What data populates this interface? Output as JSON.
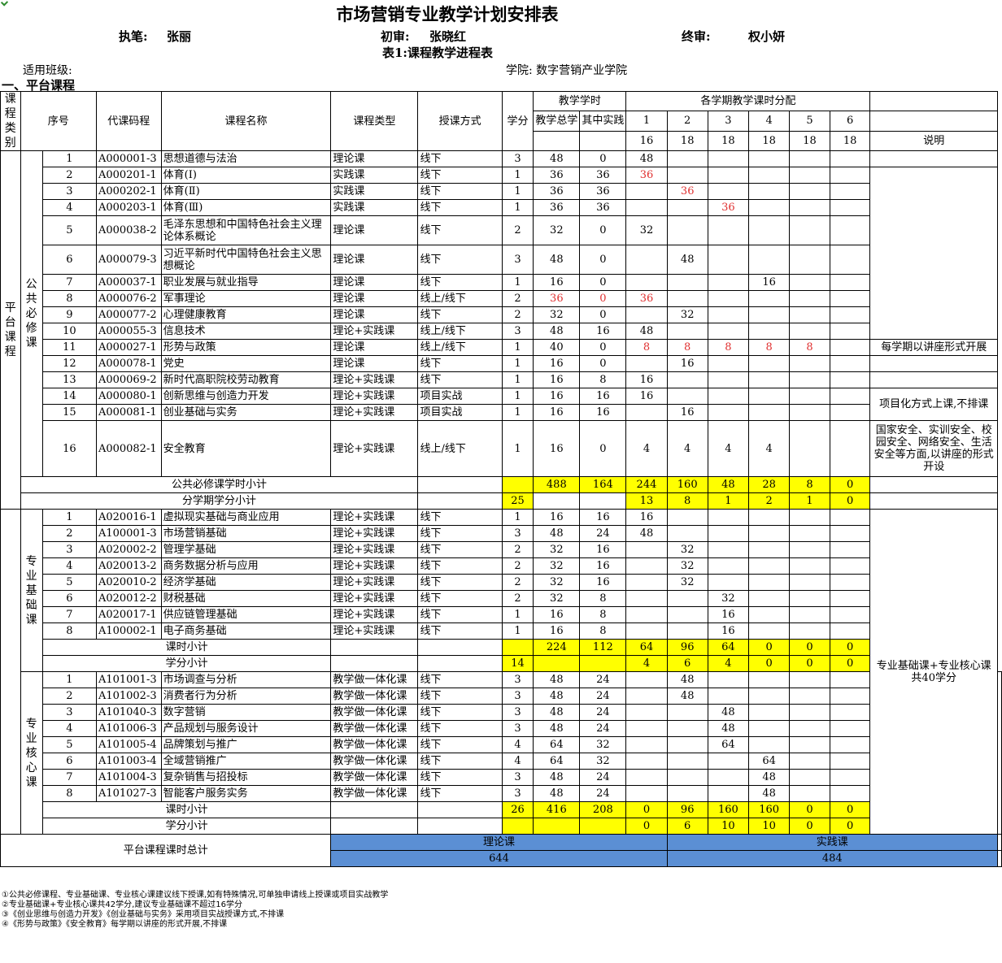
{
  "title": "市场营销专业教学计划安排表",
  "authors": {
    "writer_label": "执笔:",
    "writer": "张丽",
    "review_label": "初审:",
    "reviewer": "张晓红",
    "final_label": "终审:",
    "final": "权小妍"
  },
  "table_title": "表1:课程教学进程表",
  "class_label": "适用班级:",
  "college": "学院: 数字营销产业学院",
  "section": "一、平台课程",
  "header": {
    "category": "课程类别",
    "no": "序号",
    "code": "代课码程",
    "name": "课程名称",
    "type": "课程类型",
    "mode": "授课方式",
    "credit": "学分",
    "hours_group": "教学学时",
    "total": "教学总学",
    "practice": "其中实践",
    "sem_group": "各学期教学课时分配",
    "sems": [
      "1",
      "2",
      "3",
      "4",
      "5",
      "6"
    ],
    "weeks": [
      "16",
      "18",
      "18",
      "18",
      "18",
      "18"
    ],
    "note": "说明"
  },
  "platform_label": "平台课程",
  "groups": {
    "public": "公共必修课",
    "basic": "专业基础课",
    "core": "专业核心课"
  },
  "public_rows": [
    {
      "no": "1",
      "code": "A000001-3",
      "name": "思想道德与法治",
      "type": "理论课",
      "mode": "线下",
      "credit": "3",
      "total": "48",
      "prac": "0",
      "s": [
        "48",
        "",
        "",
        "",
        "",
        ""
      ]
    },
    {
      "no": "2",
      "code": "A000201-1",
      "name": "体育(Ⅰ)",
      "type": "实践课",
      "mode": "线下",
      "credit": "1",
      "total": "36",
      "prac": "36",
      "s": [
        "36",
        "",
        "",
        "",
        "",
        ""
      ]
    },
    {
      "no": "3",
      "code": "A000202-1",
      "name": "体育(Ⅱ)",
      "type": "实践课",
      "mode": "线下",
      "credit": "1",
      "total": "36",
      "prac": "36",
      "s": [
        "",
        "36",
        "",
        "",
        "",
        ""
      ]
    },
    {
      "no": "4",
      "code": "A000203-1",
      "name": "体育(Ⅲ)",
      "type": "实践课",
      "mode": "线下",
      "credit": "1",
      "total": "36",
      "prac": "36",
      "s": [
        "",
        "",
        "36",
        "",
        "",
        ""
      ]
    },
    {
      "no": "5",
      "code": "A000038-2",
      "name": "毛泽东思想和中国特色社会主义理论体系概论",
      "type": "理论课",
      "mode": "线下",
      "credit": "2",
      "total": "32",
      "prac": "0",
      "s": [
        "32",
        "",
        "",
        "",
        "",
        ""
      ]
    },
    {
      "no": "6",
      "code": "A000079-3",
      "name": "习近平新时代中国特色社会主义思想概论",
      "type": "理论课",
      "mode": "线下",
      "credit": "3",
      "total": "48",
      "prac": "0",
      "s": [
        "",
        "48",
        "",
        "",
        "",
        ""
      ]
    },
    {
      "no": "7",
      "code": "A000037-1",
      "name": "职业发展与就业指导",
      "type": "理论课",
      "mode": "线下",
      "credit": "1",
      "total": "16",
      "prac": "0",
      "s": [
        "",
        "",
        "",
        "16",
        "",
        ""
      ]
    },
    {
      "no": "8",
      "code": "A000076-2",
      "name": "军事理论",
      "type": "理论课",
      "mode": "线上/线下",
      "credit": "2",
      "total": "36",
      "prac": "0",
      "s": [
        "36",
        "",
        "",
        "",
        "",
        ""
      ]
    },
    {
      "no": "9",
      "code": "A000077-2",
      "name": "心理健康教育",
      "type": "理论课",
      "mode": "线下",
      "credit": "2",
      "total": "32",
      "prac": "0",
      "s": [
        "",
        "32",
        "",
        "",
        "",
        ""
      ]
    },
    {
      "no": "10",
      "code": "A000055-3",
      "name": "信息技术",
      "type": "理论+实践课",
      "mode": "线上/线下",
      "credit": "3",
      "total": "48",
      "prac": "16",
      "s": [
        "48",
        "",
        "",
        "",
        "",
        ""
      ]
    },
    {
      "no": "11",
      "code": "A000027-1",
      "name": "形势与政策",
      "type": "理论课",
      "mode": "线上/线下",
      "credit": "1",
      "total": "40",
      "prac": "0",
      "s": [
        "8",
        "8",
        "8",
        "8",
        "8",
        ""
      ]
    },
    {
      "no": "12",
      "code": "A000078-1",
      "name": "党史",
      "type": "理论课",
      "mode": "线下",
      "credit": "1",
      "total": "16",
      "prac": "0",
      "s": [
        "",
        "16",
        "",
        "",
        "",
        ""
      ]
    },
    {
      "no": "13",
      "code": "A000069-2",
      "name": "新时代高职院校劳动教育",
      "type": "理论+实践课",
      "mode": "线下",
      "credit": "1",
      "total": "16",
      "prac": "8",
      "s": [
        "16",
        "",
        "",
        "",
        "",
        ""
      ]
    },
    {
      "no": "14",
      "code": "A000080-1",
      "name": "创新思维与创造力开发",
      "type": "理论+实践课",
      "mode": "项目实战",
      "credit": "1",
      "total": "16",
      "prac": "16",
      "s": [
        "16",
        "",
        "",
        "",
        "",
        ""
      ]
    },
    {
      "no": "15",
      "code": "A000081-1",
      "name": "创业基础与实务",
      "type": "理论+实践课",
      "mode": "项目实战",
      "credit": "1",
      "total": "16",
      "prac": "16",
      "s": [
        "",
        "16",
        "",
        "",
        "",
        ""
      ]
    },
    {
      "no": "16",
      "code": "A000082-1",
      "name": "安全教育",
      "type": "理论+实践课",
      "mode": "线上/线下",
      "credit": "1",
      "total": "16",
      "prac": "0",
      "s": [
        "4",
        "4",
        "4",
        "4",
        "",
        ""
      ]
    }
  ],
  "public_notes": {
    "n11": "每学期以讲座形式开展",
    "n14": "项目化方式上课,不排课",
    "n16": "国家安全、实训安全、校园安全、网络安全、生活安全等方面,以讲座的形式开设"
  },
  "public_hours_subtotal": {
    "label": "公共必修课学时小计",
    "total": "488",
    "prac": "164",
    "s": [
      "244",
      "160",
      "48",
      "28",
      "8",
      "0"
    ]
  },
  "public_credit_subtotal": {
    "label": "分学期学分小计",
    "credit": "25",
    "s": [
      "13",
      "8",
      "1",
      "2",
      "1",
      "0"
    ]
  },
  "basic_rows": [
    {
      "no": "1",
      "code": "A020016-1",
      "name": "虚拟现实基础与商业应用",
      "type": "理论+实践课",
      "mode": "线下",
      "credit": "1",
      "total": "16",
      "prac": "16",
      "s": [
        "16",
        "",
        "",
        "",
        "",
        ""
      ]
    },
    {
      "no": "2",
      "code": "A100001-3",
      "name": "市场营销基础",
      "type": "理论+实践课",
      "mode": "线下",
      "credit": "3",
      "total": "48",
      "prac": "24",
      "s": [
        "48",
        "",
        "",
        "",
        "",
        ""
      ]
    },
    {
      "no": "3",
      "code": "A020002-2",
      "name": "管理学基础",
      "type": "理论+实践课",
      "mode": "线下",
      "credit": "2",
      "total": "32",
      "prac": "16",
      "s": [
        "",
        "32",
        "",
        "",
        "",
        ""
      ]
    },
    {
      "no": "4",
      "code": "A020013-2",
      "name": "商务数据分析与应用",
      "type": "理论+实践课",
      "mode": "线下",
      "credit": "2",
      "total": "32",
      "prac": "16",
      "s": [
        "",
        "32",
        "",
        "",
        "",
        ""
      ]
    },
    {
      "no": "5",
      "code": "A020010-2",
      "name": "经济学基础",
      "type": "理论+实践课",
      "mode": "线下",
      "credit": "2",
      "total": "32",
      "prac": "16",
      "s": [
        "",
        "32",
        "",
        "",
        "",
        ""
      ]
    },
    {
      "no": "6",
      "code": "A020012-2",
      "name": "财税基础",
      "type": "理论+实践课",
      "mode": "线下",
      "credit": "2",
      "total": "32",
      "prac": "8",
      "s": [
        "",
        "",
        "32",
        "",
        "",
        ""
      ]
    },
    {
      "no": "7",
      "code": "A020017-1",
      "name": "供应链管理基础",
      "type": "理论+实践课",
      "mode": "线下",
      "credit": "1",
      "total": "16",
      "prac": "8",
      "s": [
        "",
        "",
        "16",
        "",
        "",
        ""
      ]
    },
    {
      "no": "8",
      "code": "A100002-1",
      "name": "电子商务基础",
      "type": "理论+实践课",
      "mode": "线下",
      "credit": "1",
      "total": "16",
      "prac": "8",
      "s": [
        "",
        "",
        "16",
        "",
        "",
        ""
      ]
    }
  ],
  "basic_hours_subtotal": {
    "label": "课时小计",
    "total": "224",
    "prac": "112",
    "s": [
      "64",
      "96",
      "64",
      "0",
      "0",
      "0"
    ]
  },
  "basic_credit_subtotal": {
    "label": "学分小计",
    "credit": "14",
    "s": [
      "4",
      "6",
      "4",
      "0",
      "0",
      "0"
    ]
  },
  "basic_core_note": "专业基础课+专业核心课共40学分",
  "core_rows": [
    {
      "no": "1",
      "code": "A101001-3",
      "name": "市场调查与分析",
      "type": "教学做一体化课",
      "mode": "线下",
      "credit": "3",
      "total": "48",
      "prac": "24",
      "s": [
        "",
        "48",
        "",
        "",
        "",
        ""
      ]
    },
    {
      "no": "2",
      "code": "A101002-3",
      "name": "消费者行为分析",
      "type": "教学做一体化课",
      "mode": "线下",
      "credit": "3",
      "total": "48",
      "prac": "24",
      "s": [
        "",
        "48",
        "",
        "",
        "",
        ""
      ]
    },
    {
      "no": "3",
      "code": "A101040-3",
      "name": "数字营销",
      "type": "教学做一体化课",
      "mode": "线下",
      "credit": "3",
      "total": "48",
      "prac": "24",
      "s": [
        "",
        "",
        "48",
        "",
        "",
        ""
      ]
    },
    {
      "no": "4",
      "code": "A101006-3",
      "name": "产品规划与服务设计",
      "type": "教学做一体化课",
      "mode": "线下",
      "credit": "3",
      "total": "48",
      "prac": "24",
      "s": [
        "",
        "",
        "48",
        "",
        "",
        ""
      ]
    },
    {
      "no": "5",
      "code": "A101005-4",
      "name": "品牌策划与推广",
      "type": "教学做一体化课",
      "mode": "线下",
      "credit": "4",
      "total": "64",
      "prac": "32",
      "s": [
        "",
        "",
        "64",
        "",
        "",
        ""
      ]
    },
    {
      "no": "6",
      "code": "A101003-4",
      "name": "全域营销推广",
      "type": "教学做一体化课",
      "mode": "线下",
      "credit": "4",
      "total": "64",
      "prac": "32",
      "s": [
        "",
        "",
        "",
        "64",
        "",
        ""
      ]
    },
    {
      "no": "7",
      "code": "A101004-3",
      "name": "复杂销售与招投标",
      "type": "教学做一体化课",
      "mode": "线下",
      "credit": "3",
      "total": "48",
      "prac": "24",
      "s": [
        "",
        "",
        "",
        "48",
        "",
        ""
      ]
    },
    {
      "no": "8",
      "code": "A101027-3",
      "name": "智能客户服务实务",
      "type": "教学做一体化课",
      "mode": "线下",
      "credit": "3",
      "total": "48",
      "prac": "24",
      "s": [
        "",
        "",
        "",
        "48",
        "",
        ""
      ]
    }
  ],
  "core_hours_subtotal": {
    "label": "课时小计",
    "credit": "26",
    "total": "416",
    "prac": "208",
    "s": [
      "0",
      "96",
      "160",
      "160",
      "0",
      "0"
    ]
  },
  "core_credit_subtotal": {
    "label": "学分小计",
    "s": [
      "0",
      "6",
      "10",
      "10",
      "0",
      "0"
    ]
  },
  "platform_total": {
    "label": "平台课程课时总计",
    "theory_label": "理论课",
    "theory_value": "644",
    "practice_label": "实践课",
    "practice_value": "484"
  },
  "notes": [
    "①公共必修课程、专业基础课、专业核心课建议线下授课,如有特殊情况,可单独申请线上授课或项目实战教学",
    "②专业基础课+专业核心课共42学分,建议专业基础课不超过16学分",
    "③《创业思维与创造力开发》《创业基础与实务》采用项目实战授课方式,不排课",
    "④《形势与政策》《安全教育》每学期以讲座的形式开展,不排课"
  ],
  "colors": {
    "subtotal": "#ffff00",
    "total": "#5b8fd4",
    "red_values": "#e03030"
  }
}
